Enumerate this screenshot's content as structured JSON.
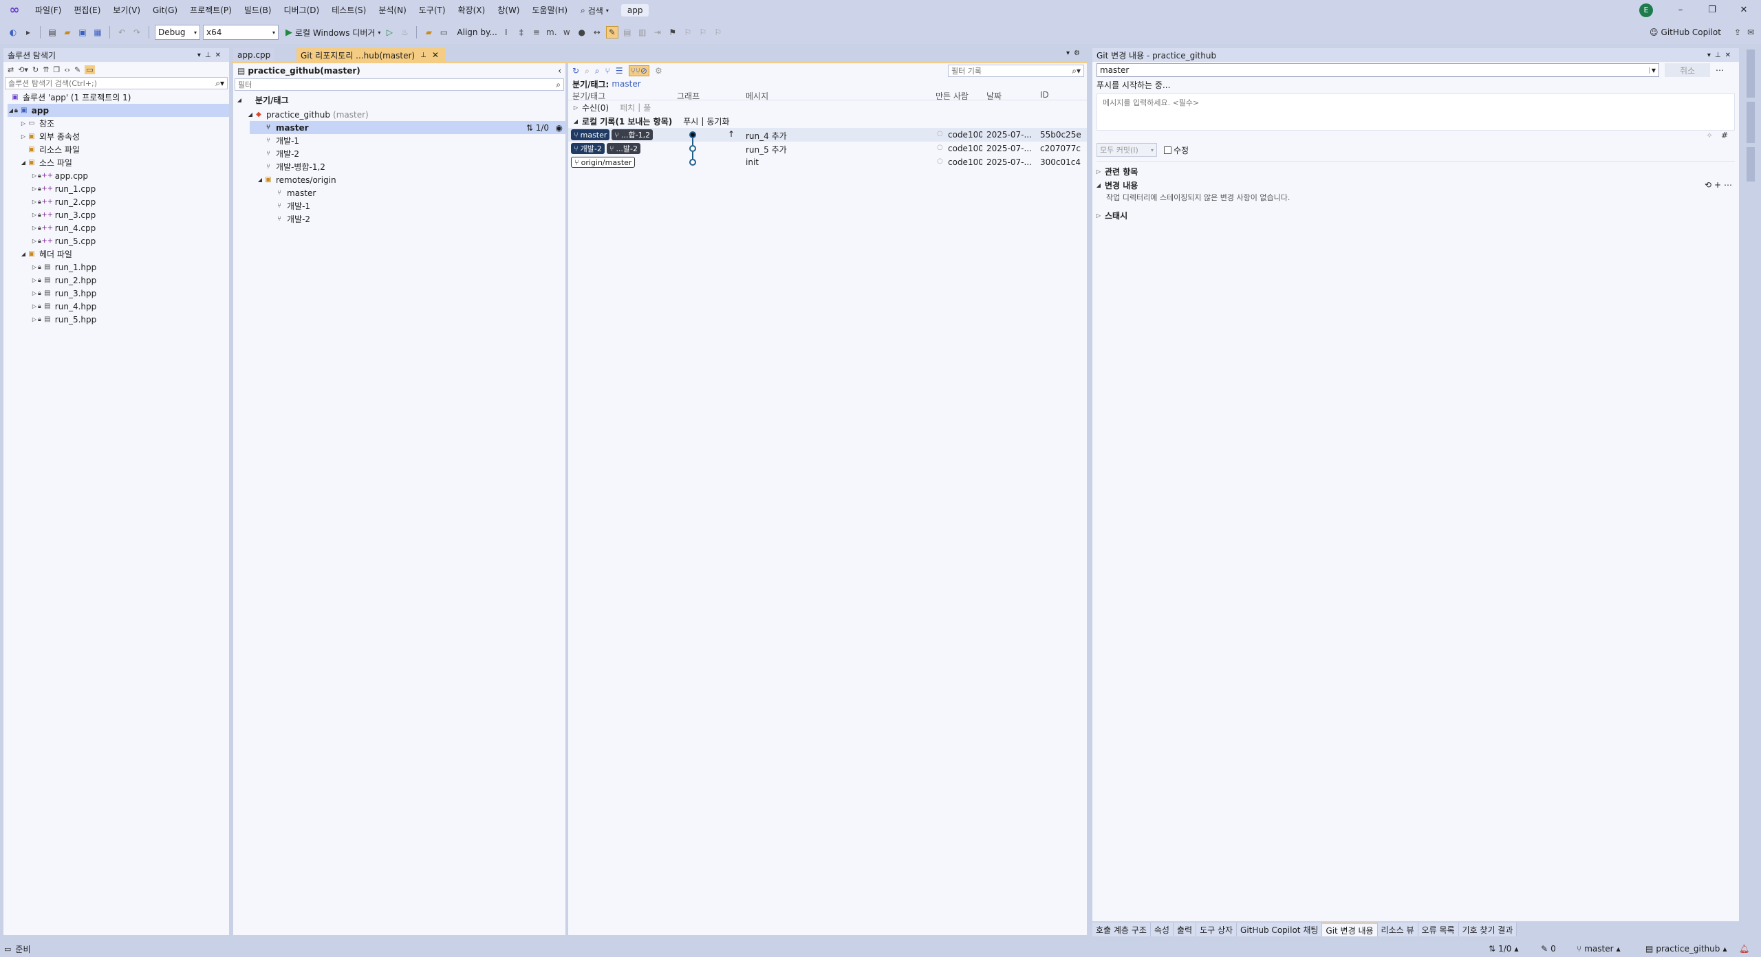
{
  "menu": {
    "items": [
      "파일(F)",
      "편집(E)",
      "보기(V)",
      "Git(G)",
      "프로젝트(P)",
      "빌드(B)",
      "디버그(D)",
      "테스트(S)",
      "분석(N)",
      "도구(T)",
      "확장(X)",
      "창(W)",
      "도움말(H)"
    ],
    "search_label": "검색",
    "solution_name": "app",
    "avatar_initial": "E"
  },
  "toolbar": {
    "config": "Debug",
    "platform": "x64",
    "run_label": "로컬 Windows 디버거",
    "align_label": "Align by...",
    "copilot_label": "GitHub Copilot"
  },
  "solution_explorer": {
    "title": "솔루션 탐색기",
    "search_placeholder": "솔루션 탐색기 검색(Ctrl+;)",
    "solution_label": "솔루션 'app' (1 프로젝트의 1)",
    "project": "app",
    "references": "참조",
    "external": "외부 종속성",
    "resources": "리소스 파일",
    "source_folder": "소스 파일",
    "source_files": [
      "app.cpp",
      "run_1.cpp",
      "run_2.cpp",
      "run_3.cpp",
      "run_4.cpp",
      "run_5.cpp"
    ],
    "header_folder": "헤더 파일",
    "header_files": [
      "run_1.hpp",
      "run_2.hpp",
      "run_3.hpp",
      "run_4.hpp",
      "run_5.hpp"
    ]
  },
  "doc_tabs": {
    "tab1": "app.cpp",
    "tab2": "Git 리포지토리 ...hub(master)"
  },
  "branches": {
    "repo_title": "practice_github(master)",
    "filter_placeholder": "필터",
    "section": "분기/태그",
    "repo": "practice_github",
    "repo_branch": "(master)",
    "local": [
      "master",
      "개발-1",
      "개발-2",
      "개발-병합-1,2"
    ],
    "master_sync": "1/0",
    "remotes_label": "remotes/origin",
    "remotes": [
      "master",
      "개발-1",
      "개발-2"
    ]
  },
  "history": {
    "filter_placeholder": "필터 기록",
    "branch_label": "분기/태그:",
    "branch_value": "master",
    "columns": [
      "분기/태그",
      "그래프",
      "메시지",
      "만든 사람",
      "날짜",
      "ID"
    ],
    "incoming_label": "수신(0)",
    "incoming_fetch": "페치",
    "incoming_pull": "풀",
    "outgoing_label": "로컬 기록(1 보내는 항목)",
    "outgoing_push": "푸시",
    "outgoing_sync": "동기화",
    "commits": [
      {
        "badges": [
          "master",
          "...합-1,2"
        ],
        "message": "run_4 추가",
        "author": "code100",
        "date": "2025-07-...",
        "id": "55b0c25e"
      },
      {
        "badges": [
          "개발-2",
          "...발-2"
        ],
        "message": "run_5 추가",
        "author": "code100",
        "date": "2025-07-...",
        "id": "c207077c"
      },
      {
        "badges": [
          "origin/master"
        ],
        "message": "init",
        "author": "code100",
        "date": "2025-07-...",
        "id": "300c01c4"
      }
    ]
  },
  "git_changes": {
    "title": "Git 변경 내용 - practice_github",
    "branch": "master",
    "cancel": "취소",
    "status": "푸시를 시작하는 중...",
    "message_placeholder": "메시지를 입력하세요. <필수>",
    "commit_all": "모두 커밋(I)",
    "amend": "수정",
    "related": "관련 항목",
    "changes": "변경 내용",
    "no_changes": "작업 디렉터리에 스테이징되지 않은 변경 사항이 없습니다.",
    "stash": "스태시"
  },
  "bottom_tabs": [
    "호출 계층 구조",
    "속성",
    "출력",
    "도구 상자",
    "GitHub Copilot 채팅",
    "Git 변경 내용",
    "리소스 뷰",
    "오류 목록",
    "기호 찾기 결과"
  ],
  "statusbar": {
    "ready": "준비",
    "sync": "1/0",
    "edits": "0",
    "branch": "master",
    "repo": "practice_github"
  },
  "colors": {
    "accent": "#f5cc84",
    "selection": "#c6d4f7",
    "badge_local": "#1f3b63",
    "graph": "#1e5d8b"
  }
}
